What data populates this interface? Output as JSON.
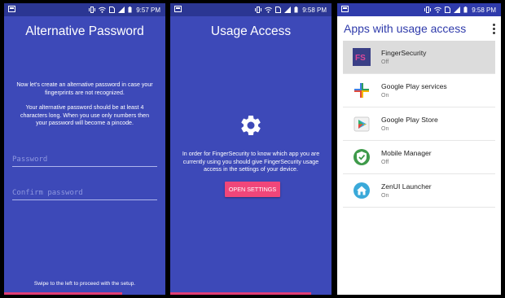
{
  "status_bar": [
    {
      "time": "9:57 PM"
    },
    {
      "time": "9:58 PM"
    },
    {
      "time": "9:58 PM"
    }
  ],
  "screen1": {
    "title": "Alternative Password",
    "intro": "Now let's create an alternative password in case your fingerprints are not recognized.",
    "detail": "Your alternative password should be at least 4 characters long. When you use only numbers then your password will become a pincode.",
    "password_placeholder": "Password",
    "confirm_placeholder": "Confirm password",
    "footer": "Swipe to the left to proceed with the setup."
  },
  "screen2": {
    "title": "Usage Access",
    "body": "In order for FingerSecurity to know which app you are currently using you should give FingerSecurity usage access in the settings of your device.",
    "button_label": "OPEN SETTINGS"
  },
  "screen3": {
    "title": "Apps with usage access",
    "apps": [
      {
        "name": "FingerSecurity",
        "status": "Off",
        "icon": "fingersecurity-icon"
      },
      {
        "name": "Google Play services",
        "status": "On",
        "icon": "google-play-services-icon"
      },
      {
        "name": "Google Play Store",
        "status": "On",
        "icon": "google-play-store-icon"
      },
      {
        "name": "Mobile Manager",
        "status": "Off",
        "icon": "mobile-manager-icon"
      },
      {
        "name": "ZenUI Launcher",
        "status": "On",
        "icon": "zenui-launcher-icon"
      }
    ]
  },
  "colors": {
    "primary": "#3d49b8",
    "status_bar": "#2b3693",
    "accent": "#f0467a"
  }
}
